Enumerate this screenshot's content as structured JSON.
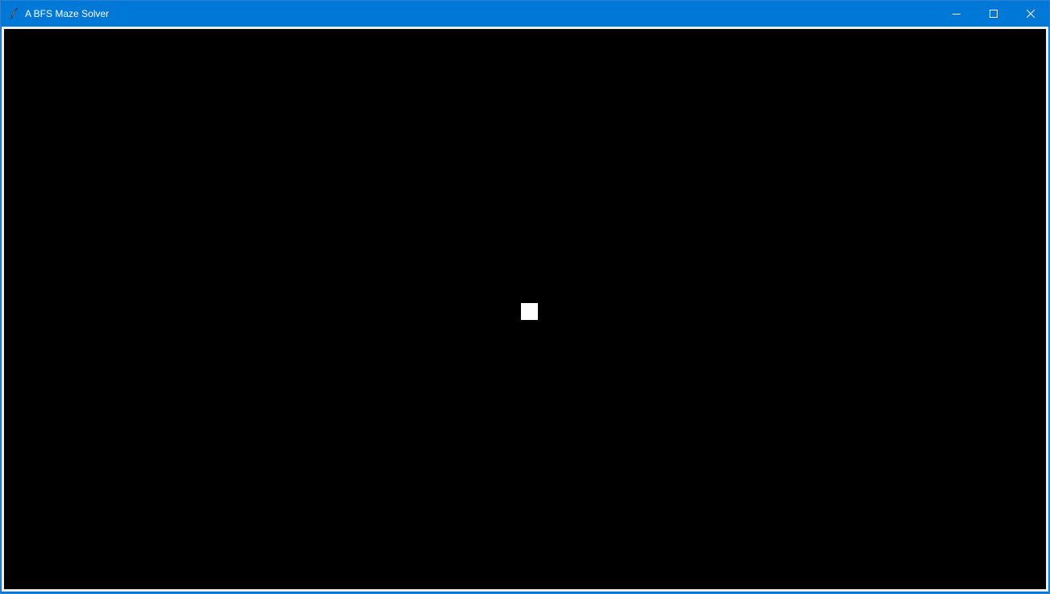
{
  "window": {
    "title": "A BFS Maze Solver",
    "app_icon": "feather-icon",
    "controls": {
      "minimize_icon": "minimize-icon",
      "maximize_icon": "maximize-icon",
      "close_icon": "close-icon"
    },
    "colors": {
      "titlebar": "#0078d7",
      "canvas_background": "#000000",
      "cell": "#ffffff"
    }
  },
  "maze": {
    "visible_cells": 1
  }
}
